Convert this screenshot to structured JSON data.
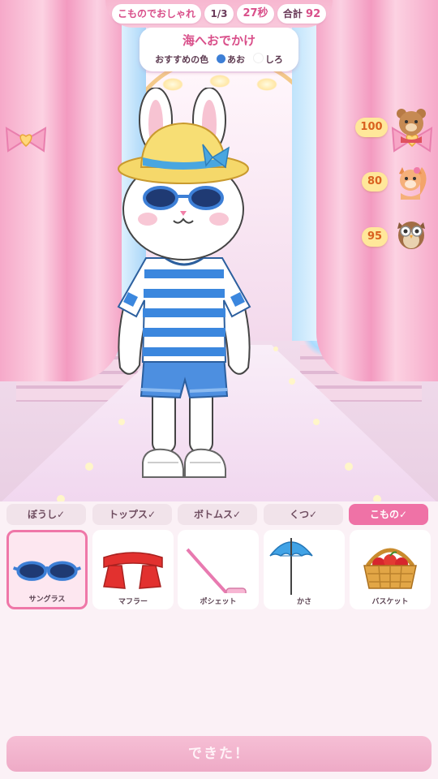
{
  "header": {
    "game_title": "こものでおしゃれ",
    "round": "1/3",
    "timer": "27秒",
    "total_label": "合計",
    "total_value": "92"
  },
  "theme_card": {
    "title": "海へおでかけ",
    "recommend_label": "おすすめの色",
    "colors": [
      {
        "name": "あお",
        "hex": "#3d7fd6"
      },
      {
        "name": "しろ",
        "hex": "#ffffff"
      }
    ]
  },
  "judges": [
    {
      "icon": "bear-judge-icon",
      "score": "100"
    },
    {
      "icon": "squirrel-judge-icon",
      "score": "80"
    },
    {
      "icon": "owl-judge-icon",
      "score": "95"
    }
  ],
  "tabs": [
    {
      "label": "ぼうし✓",
      "active": false
    },
    {
      "label": "トップス✓",
      "active": false
    },
    {
      "label": "ボトムス✓",
      "active": false
    },
    {
      "label": "くつ✓",
      "active": false
    },
    {
      "label": "こもの✓",
      "active": true
    }
  ],
  "items": [
    {
      "label": "サングラス",
      "icon": "sunglasses-icon",
      "selected": true
    },
    {
      "label": "マフラー",
      "icon": "scarf-icon",
      "selected": false
    },
    {
      "label": "ポシェット",
      "icon": "pochette-icon",
      "selected": false
    },
    {
      "label": "かさ",
      "icon": "umbrella-icon",
      "selected": false
    },
    {
      "label": "バスケット",
      "icon": "basket-icon",
      "selected": false
    }
  ],
  "done_button": "できた！",
  "colors": {
    "accent": "#ef72a6",
    "tab_inactive": "#f1e3ea",
    "score_bg": "#ffe79a"
  }
}
